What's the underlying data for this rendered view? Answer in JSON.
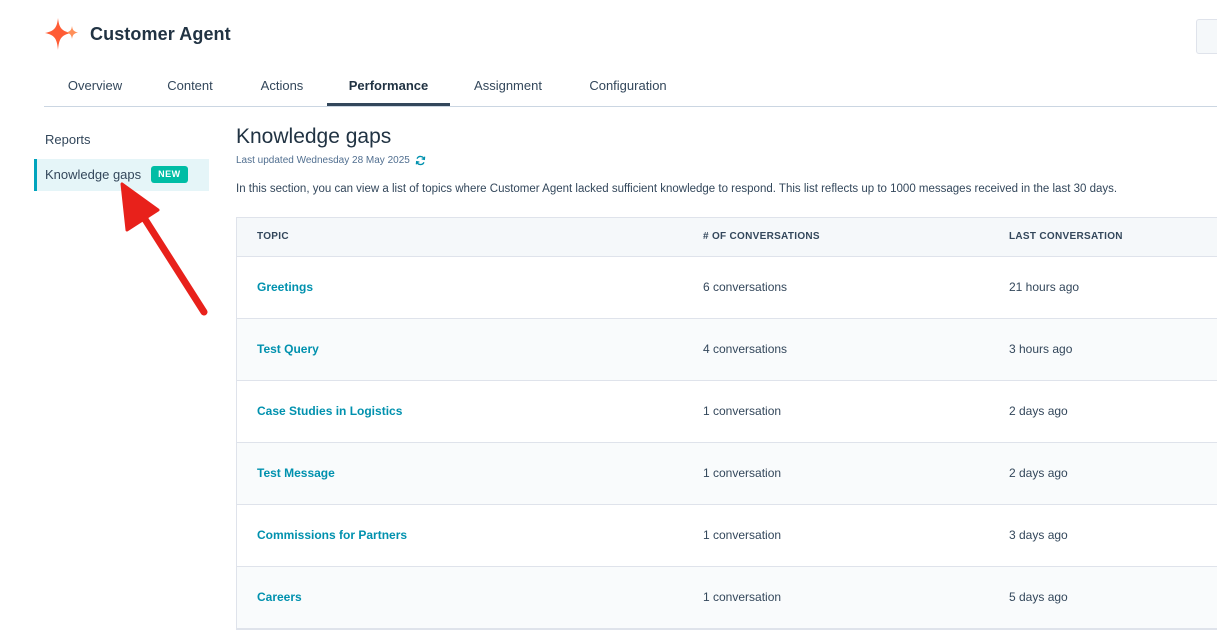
{
  "app": {
    "title": "Customer Agent"
  },
  "tabs": [
    {
      "label": "Overview"
    },
    {
      "label": "Content"
    },
    {
      "label": "Actions"
    },
    {
      "label": "Performance",
      "active": true
    },
    {
      "label": "Assignment"
    },
    {
      "label": "Configuration"
    }
  ],
  "sidebar": {
    "items": [
      {
        "label": "Reports"
      },
      {
        "label": "Knowledge gaps",
        "badge": "NEW",
        "active": true
      }
    ]
  },
  "main": {
    "title": "Knowledge gaps",
    "last_updated": "Last updated Wednesday 28 May 2025",
    "description": "In this section, you can view a list of topics where Customer Agent lacked sufficient knowledge to respond. This list reflects up to 1000 messages received in the last 30 days."
  },
  "table": {
    "headers": [
      "TOPIC",
      "# OF CONVERSATIONS",
      "LAST CONVERSATION"
    ],
    "rows": [
      {
        "topic": "Greetings",
        "conversations": "6 conversations",
        "last": "21 hours ago"
      },
      {
        "topic": "Test Query",
        "conversations": "4 conversations",
        "last": "3 hours ago"
      },
      {
        "topic": "Case Studies in Logistics",
        "conversations": "1 conversation",
        "last": "2 days ago"
      },
      {
        "topic": "Test Message",
        "conversations": "1 conversation",
        "last": "2 days ago"
      },
      {
        "topic": "Commissions for Partners",
        "conversations": "1 conversation",
        "last": "3 days ago"
      },
      {
        "topic": "Careers",
        "conversations": "1 conversation",
        "last": "5 days ago"
      }
    ]
  },
  "colors": {
    "accent_teal": "#00a4bd",
    "link": "#0091ae",
    "badge": "#00bda5",
    "logo_orange": "#ff5c35",
    "arrow_red": "#e8211b"
  },
  "icons": {
    "logo": "sparkle-logo-icon",
    "refresh": "refresh-icon",
    "annotation": "red-arrow-annotation"
  }
}
